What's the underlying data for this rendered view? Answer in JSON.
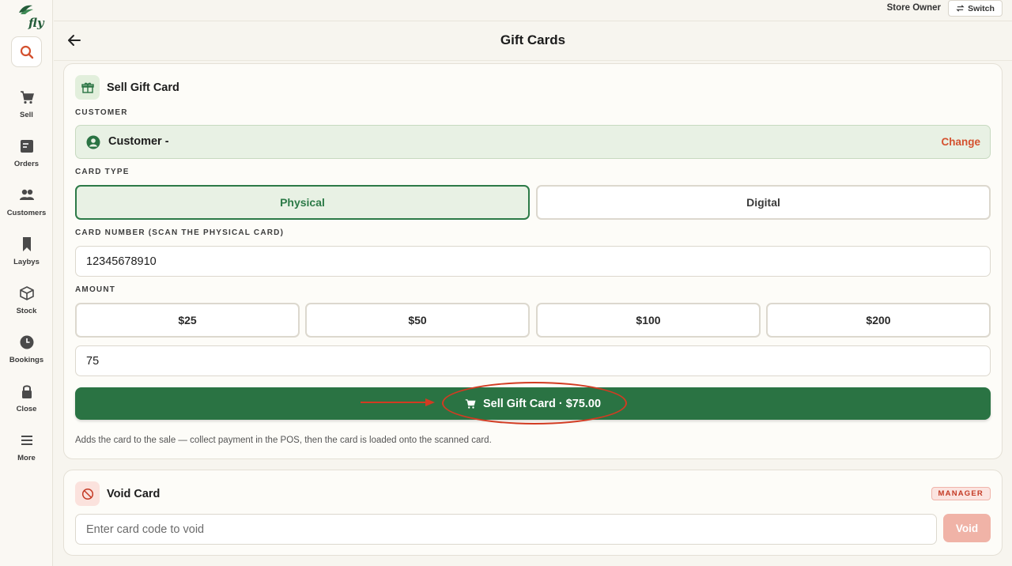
{
  "app": {
    "logo_text": "fly"
  },
  "topbar": {
    "user_role": "Store Owner",
    "switch_label": "Switch"
  },
  "header": {
    "title": "Gift Cards"
  },
  "sidebar": {
    "items": [
      {
        "label": "Sell",
        "icon": "cart-icon"
      },
      {
        "label": "Orders",
        "icon": "orders-icon"
      },
      {
        "label": "Customers",
        "icon": "customers-icon"
      },
      {
        "label": "Laybys",
        "icon": "bookmark-icon"
      },
      {
        "label": "Stock",
        "icon": "box-icon"
      },
      {
        "label": "Bookings",
        "icon": "clock-icon"
      },
      {
        "label": "Close",
        "icon": "lock-icon"
      },
      {
        "label": "More",
        "icon": "menu-icon"
      }
    ]
  },
  "sell_card": {
    "title": "Sell Gift Card",
    "customer_label": "CUSTOMER",
    "customer_name": "Customer -",
    "change_label": "Change",
    "card_type_label": "CARD TYPE",
    "card_types": [
      "Physical",
      "Digital"
    ],
    "selected_card_type": "Physical",
    "card_number_label": "CARD NUMBER (SCAN THE PHYSICAL CARD)",
    "card_number_value": "12345678910",
    "amount_label": "AMOUNT",
    "amounts": [
      "$25",
      "$50",
      "$100",
      "$200"
    ],
    "custom_amount_value": "75",
    "sell_button_label": "Sell Gift Card · $75.00",
    "help_text": "Adds the card to the sale — collect payment in the POS, then the card is loaded onto the scanned card."
  },
  "void_card": {
    "title": "Void Card",
    "badge": "MANAGER",
    "input_placeholder": "Enter card code to void",
    "void_button_label": "Void"
  },
  "colors": {
    "brand_green": "#2a7343",
    "selected_bg": "#e8f1e4",
    "accent_red": "#d4512f",
    "annotation_red": "#d23b22"
  }
}
